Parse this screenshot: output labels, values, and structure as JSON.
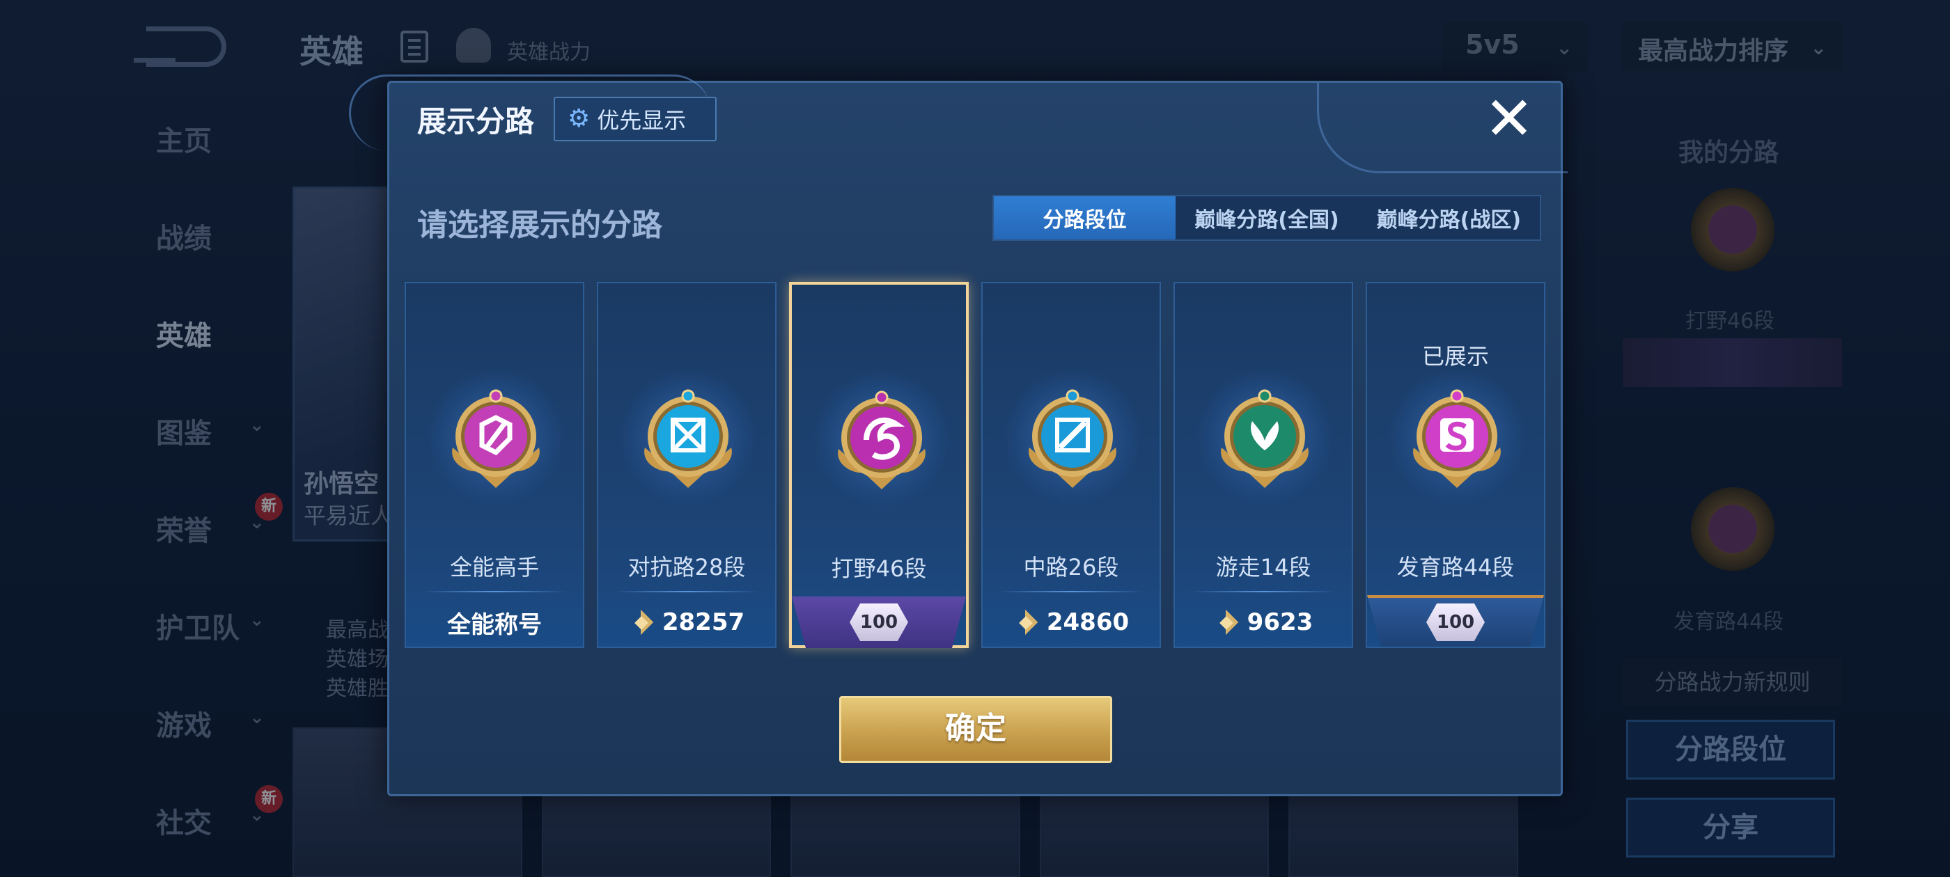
{
  "background": {
    "header": {
      "title": "英雄",
      "power_label": "英雄战力",
      "mode": "5v5",
      "sort": "最高战力排序"
    },
    "nav": [
      {
        "label": "主页",
        "has_chevron": false,
        "new": false,
        "active": false
      },
      {
        "label": "战绩",
        "has_chevron": false,
        "new": false,
        "active": false
      },
      {
        "label": "英雄",
        "has_chevron": false,
        "new": false,
        "active": true
      },
      {
        "label": "图鉴",
        "has_chevron": true,
        "new": false,
        "active": false
      },
      {
        "label": "荣誉",
        "has_chevron": true,
        "new": true,
        "active": false
      },
      {
        "label": "护卫队",
        "has_chevron": true,
        "new": false,
        "active": false
      },
      {
        "label": "游戏",
        "has_chevron": true,
        "new": false,
        "active": false
      },
      {
        "label": "社交",
        "has_chevron": true,
        "new": true,
        "active": false
      }
    ],
    "new_badge": "新",
    "hero": {
      "name": "孙悟空",
      "sub": "平易近人",
      "stats": [
        "最高战",
        "英雄场",
        "英雄胜"
      ]
    },
    "right_panel": {
      "title": "我的分路",
      "lane1": "打野46段",
      "lane2": "发育路44段",
      "rules": "分路战力新规则",
      "rank_button": "分路段位",
      "share_button": "分享"
    }
  },
  "modal": {
    "title": "展示分路",
    "priority_button": "优先显示",
    "close_icon": "close-icon",
    "subtitle": "请选择展示的分路",
    "tabs": [
      {
        "label": "分路段位",
        "active": true
      },
      {
        "label": "巅峰分路(全国)",
        "active": false
      },
      {
        "label": "巅峰分路(战区)",
        "active": false
      }
    ],
    "cards": [
      {
        "title": "全能高手",
        "footer_type": "text",
        "footer": "全能称号",
        "emblem_color": "#c23fb8",
        "emblem_icon": "all-round-icon",
        "selected": false,
        "shown_label": ""
      },
      {
        "title": "对抗路28段",
        "footer_type": "power",
        "footer": "28257",
        "emblem_color": "#1aa7e0",
        "emblem_icon": "clash-lane-icon",
        "selected": false,
        "shown_label": ""
      },
      {
        "title": "打野46段",
        "footer_type": "rank",
        "footer": "100",
        "ribbon": "purple",
        "emblem_color": "#b92fb0",
        "emblem_icon": "jungle-icon",
        "selected": true,
        "shown_label": ""
      },
      {
        "title": "中路26段",
        "footer_type": "power",
        "footer": "24860",
        "emblem_color": "#1a9ad8",
        "emblem_icon": "mid-lane-icon",
        "selected": false,
        "shown_label": ""
      },
      {
        "title": "游走14段",
        "footer_type": "power",
        "footer": "9623",
        "emblem_color": "#1d8a6a",
        "emblem_icon": "roam-icon",
        "selected": false,
        "shown_label": ""
      },
      {
        "title": "发育路44段",
        "footer_type": "rank",
        "footer": "100",
        "ribbon": "gold",
        "emblem_color": "#d03fc8",
        "emblem_icon": "farm-lane-icon",
        "selected": false,
        "shown_label": "已展示"
      }
    ],
    "confirm_button": "确定"
  },
  "colors": {
    "accent_tab": "#2f7ed4",
    "confirm_gold": "#c9a14f",
    "selected_border": "#f2d49a"
  }
}
